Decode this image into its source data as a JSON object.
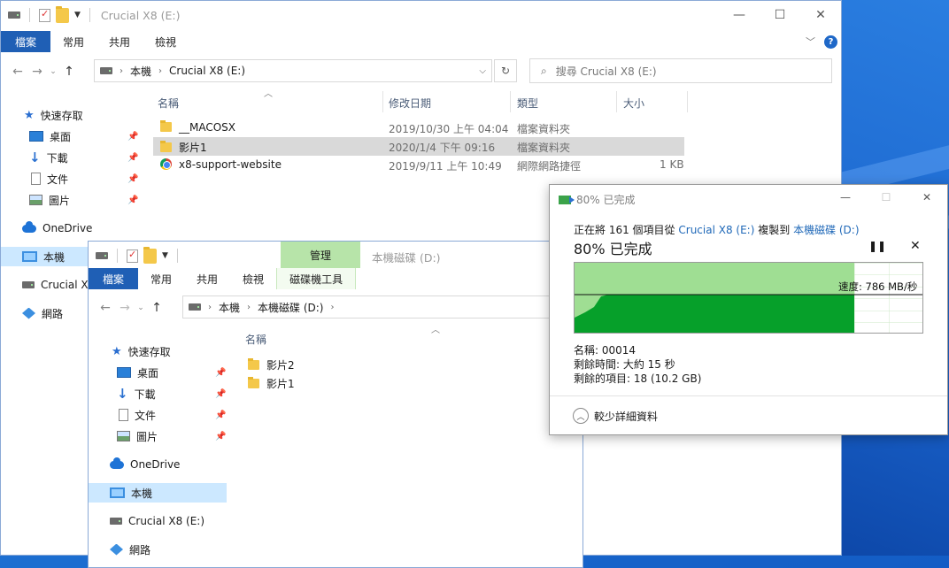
{
  "window1": {
    "title": "Crucial X8 (E:)",
    "ribbon_tabs": [
      "檔案",
      "常用",
      "共用",
      "檢視"
    ],
    "breadcrumb": [
      "本機",
      "Crucial X8 (E:)"
    ],
    "search_placeholder": "搜尋 Crucial X8 (E:)",
    "columns": [
      "名稱",
      "修改日期",
      "類型",
      "大小"
    ],
    "files": [
      {
        "name": "__MACOSX",
        "date": "2019/10/30 上午 04:04",
        "type": "檔案資料夾",
        "size": "",
        "icon": "folder-icon"
      },
      {
        "name": "影片1",
        "date": "2020/1/4 下午 09:16",
        "type": "檔案資料夾",
        "size": "",
        "icon": "folder-icon"
      },
      {
        "name": "x8-support-website",
        "date": "2019/9/11 上午 10:49",
        "type": "網際網路捷徑",
        "size": "1 KB",
        "icon": "chrome-icon"
      }
    ],
    "sidebar": [
      "快速存取",
      "桌面",
      "下載",
      "文件",
      "圖片",
      "OneDrive",
      "本機",
      "Crucial X8",
      "網路"
    ]
  },
  "window2": {
    "title": "本機磁碟 (D:)",
    "ribbon_tabs": [
      "檔案",
      "常用",
      "共用",
      "檢視"
    ],
    "context_tab": "管理",
    "context_subtab": "磁碟機工具",
    "breadcrumb": [
      "本機",
      "本機磁碟 (D:)"
    ],
    "column": "名稱",
    "files": [
      "影片2",
      "影片1"
    ],
    "sidebar": [
      "快速存取",
      "桌面",
      "下載",
      "文件",
      "圖片",
      "OneDrive",
      "本機",
      "Crucial X8 (E:)",
      "網路"
    ]
  },
  "dialog": {
    "title": "80% 已完成",
    "status_prefix": "正在將 161 個項目從",
    "source": "Crucial X8 (E:)",
    "copy_to": "複製到",
    "destination": "本機磁碟 (D:)",
    "progress_label": "80% 已完成",
    "progress_fraction": 0.8,
    "speed": "速度: 786 MB/秒",
    "name_line": "名稱: 00014",
    "time_left": "剩餘時間: 大約 15 秒",
    "items_left": "剩餘的項目: 18 (10.2 GB)",
    "fewer_details": "較少詳細資料",
    "colors": {
      "fill": "#06a02a",
      "fill_light": "#9fde93",
      "link": "#1f68b8"
    }
  }
}
